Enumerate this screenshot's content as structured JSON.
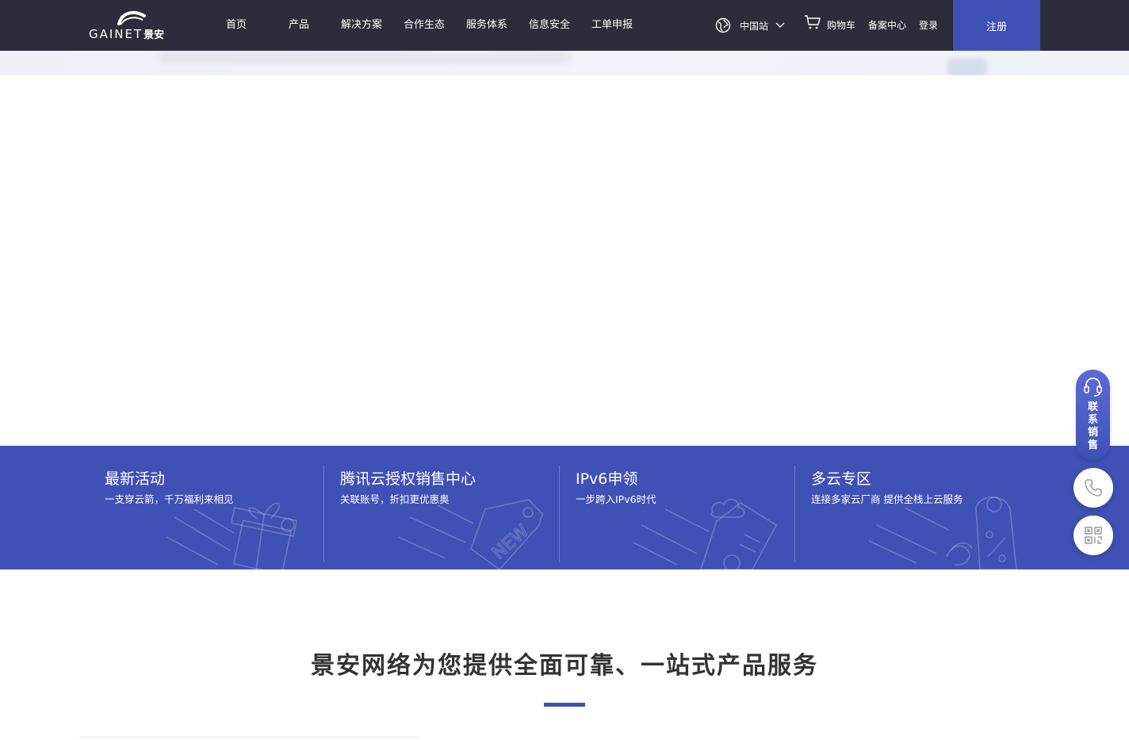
{
  "brand": {
    "logo_latin": "GAINET",
    "logo_cn": "景安"
  },
  "nav": {
    "items": [
      {
        "label": "首页"
      },
      {
        "label": "产品"
      },
      {
        "label": "解决方案"
      },
      {
        "label": "合作生态"
      },
      {
        "label": "服务体系"
      },
      {
        "label": "信息安全"
      },
      {
        "label": "工单申报"
      }
    ]
  },
  "header": {
    "region_label": "中国站",
    "region_icon": "globe-icon",
    "cart_label": "购物车",
    "cart_icon": "shopping-cart-icon",
    "record_center_label": "备案中心",
    "login_label": "登录",
    "register_label": "注册"
  },
  "promo": {
    "cards": [
      {
        "title": "最新活动",
        "subtitle": "一支穿云箭，千万福利来相见",
        "icon": "gift-icon"
      },
      {
        "title": "腾讯云授权销售中心",
        "subtitle": "关联账号，折扣更优惠奥",
        "icon": "new-tag-icon"
      },
      {
        "title": "IPv6申领",
        "subtitle": "一步跨入IPv6时代",
        "icon": "cloud-clipboard-icon"
      },
      {
        "title": "多云专区",
        "subtitle": "连接多家云厂商 提供全栈上云服务",
        "icon": "discount-tag-icon"
      }
    ]
  },
  "section": {
    "title": "景安网络为您提供全面可靠、一站式产品服务"
  },
  "floating": {
    "contact_sales_label": "联系销售",
    "contact_sales_icon": "headset-icon",
    "phone_icon": "phone-icon",
    "qr_icon": "qr-code-icon"
  },
  "colors": {
    "header_bg": "#2b2d3a",
    "accent": "#3f51b5",
    "promo_bg": "#4051b5"
  }
}
